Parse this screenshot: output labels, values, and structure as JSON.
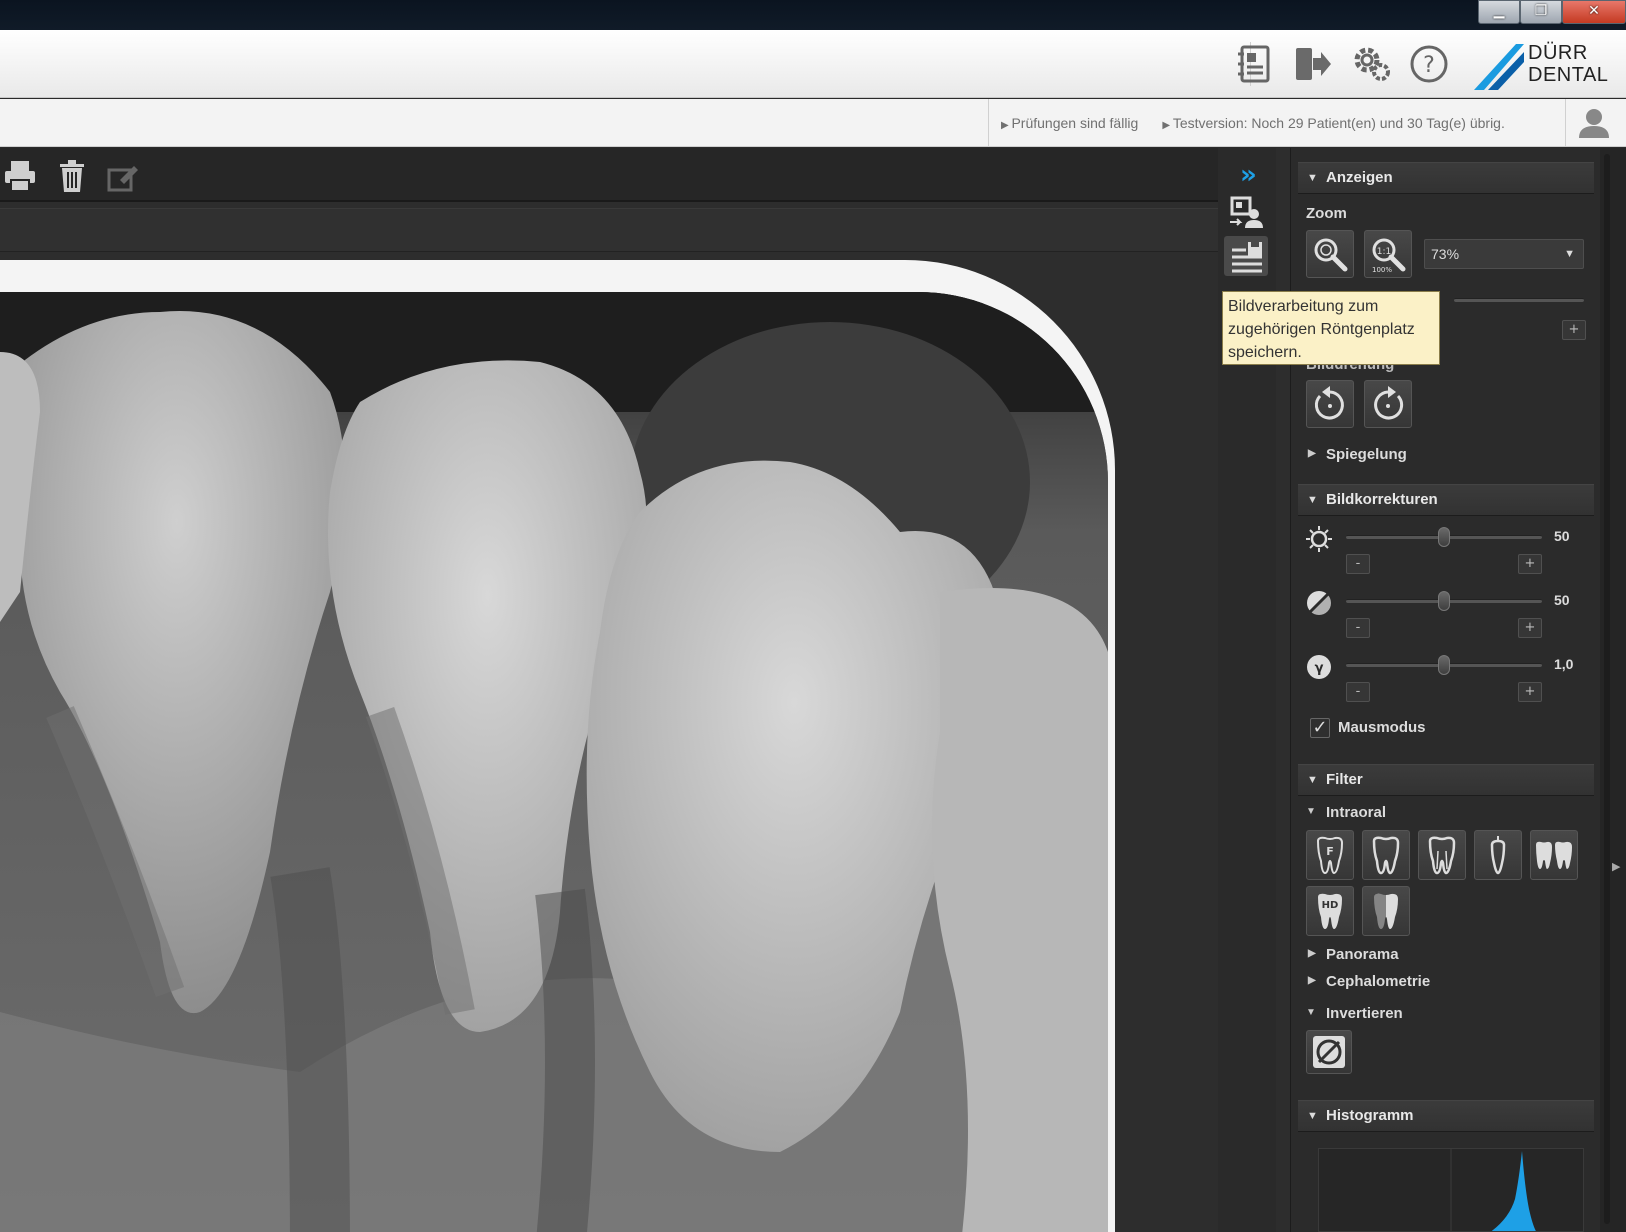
{
  "window": {
    "minimize_label": "▁",
    "restore_label": "❐",
    "close_label": "✕"
  },
  "header": {
    "icons": [
      "patient-card-icon",
      "logout-icon",
      "settings-icon",
      "help-icon"
    ],
    "logo_line1": "DÜRR",
    "logo_line2": "DENTAL",
    "logo_colors": [
      "#1a9be0",
      "#0a5fa8"
    ]
  },
  "status": {
    "item1": "Prüfungen sind fällig",
    "item2": "Testversion: Noch 29 Patient(en) und 30 Tag(e) übrig."
  },
  "tooltip": {
    "line1": "Bildverarbeitung zum",
    "line2": "zugehörigen Röntgenplatz",
    "line3": "speichern."
  },
  "panel": {
    "anzeigen": {
      "title": "Anzeigen",
      "zoom_label": "Zoom",
      "zoom_value": "73%",
      "rotation_label": "Bilddrehung",
      "spiegelung_label": "Spiegelung"
    },
    "korrekturen": {
      "title": "Bildkorrekturen",
      "brightness_value": "50",
      "contrast_value": "50",
      "gamma_value": "1,0",
      "brightness_level": 0.5,
      "contrast_level": 0.5,
      "gamma_level": 0.5,
      "minus": "-",
      "plus": "+",
      "mausmodus_label": "Mausmodus",
      "mausmodus_checked": true
    },
    "filter": {
      "title": "Filter",
      "intraoral_label": "Intraoral",
      "panorama_label": "Panorama",
      "cephalometrie_label": "Cephalometrie",
      "invertieren_label": "Invertieren"
    },
    "histogramm": {
      "title": "Histogramm"
    }
  },
  "colors": {
    "accent": "#1ea0e6",
    "tooltip_bg": "#fbf1c7",
    "panel_bg": "#2b2b2b"
  }
}
